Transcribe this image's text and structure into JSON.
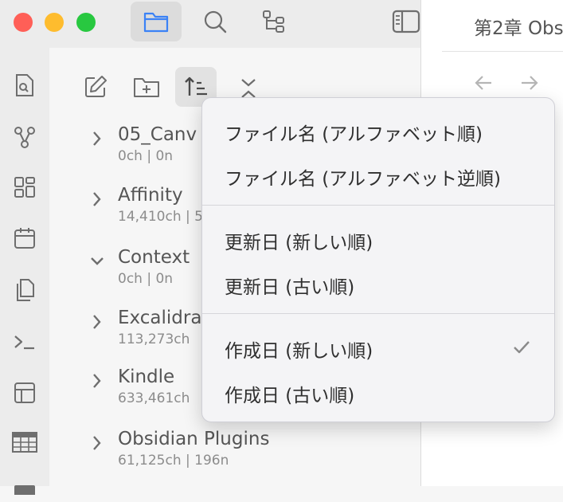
{
  "titlebar": {
    "traffic_lights": [
      {
        "name": "close",
        "color": "#ff5f57"
      },
      {
        "name": "minimize",
        "color": "#febc2e"
      },
      {
        "name": "zoom",
        "color": "#28c840"
      }
    ],
    "buttons": [
      "files-icon",
      "search-icon",
      "bookmarks-icon",
      "sidebar-toggle-icon"
    ]
  },
  "tab": {
    "title": "第2章 Obs"
  },
  "ribbon": {
    "icons": [
      "search-file-icon",
      "graph-view-icon",
      "canvas-icon",
      "calendar-icon",
      "copy-icon",
      "command-palette-icon",
      "templates-icon",
      "table-icon"
    ]
  },
  "explorer": {
    "nav": [
      "new-note-icon",
      "new-folder-icon",
      "sort-icon",
      "collapse-all-icon"
    ],
    "items": [
      {
        "name": "05_Canv",
        "meta": "0ch | 0n",
        "expanded": false
      },
      {
        "name": "Affinity",
        "meta": "14,410ch | 5",
        "expanded": false
      },
      {
        "name": "Context",
        "meta": "0ch | 0n",
        "expanded": true
      },
      {
        "name": "Excalidra",
        "meta": "113,273ch",
        "expanded": false
      },
      {
        "name": "Kindle",
        "meta": "633,461ch",
        "expanded": false
      },
      {
        "name": "Obsidian Plugins",
        "meta": "61,125ch | 196n",
        "expanded": false
      }
    ]
  },
  "sort_menu": {
    "groups": [
      [
        {
          "label": "ファイル名 (アルファベット順)",
          "checked": false
        },
        {
          "label": "ファイル名 (アルファベット逆順)",
          "checked": false
        }
      ],
      [
        {
          "label": "更新日 (新しい順)",
          "checked": false
        },
        {
          "label": "更新日 (古い順)",
          "checked": false
        }
      ],
      [
        {
          "label": "作成日 (新しい順)",
          "checked": true
        },
        {
          "label": "作成日 (古い順)",
          "checked": false
        }
      ]
    ]
  },
  "colors": {
    "accent": "#3b82f6",
    "icon": "#6e6e6e"
  }
}
